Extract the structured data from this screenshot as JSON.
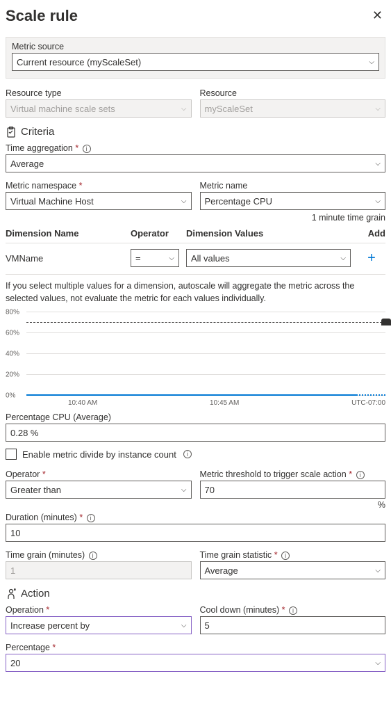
{
  "header": {
    "title": "Scale rule"
  },
  "metric_source": {
    "label": "Metric source",
    "value": "Current resource (myScaleSet)"
  },
  "resource_type": {
    "label": "Resource type",
    "value": "Virtual machine scale sets"
  },
  "resource": {
    "label": "Resource",
    "value": "myScaleSet"
  },
  "criteria": {
    "title": "Criteria",
    "time_agg": {
      "label": "Time aggregation",
      "value": "Average"
    },
    "namespace": {
      "label": "Metric namespace",
      "value": "Virtual Machine Host"
    },
    "metric_name": {
      "label": "Metric name",
      "value": "Percentage CPU"
    },
    "time_grain_note": "1 minute time grain",
    "table": {
      "h_name": "Dimension Name",
      "h_op": "Operator",
      "h_val": "Dimension Values",
      "h_add": "Add",
      "row_name": "VMName",
      "row_op": "=",
      "row_val": "All values"
    },
    "help": "If you select multiple values for a dimension, autoscale will aggregate the metric across the selected values, not evaluate the metric for each values individually.",
    "chart_metric_label": "Percentage CPU (Average)",
    "chart_metric_value": "0.28 %",
    "divide_label": "Enable metric divide by instance count",
    "operator": {
      "label": "Operator",
      "value": "Greater than"
    },
    "threshold": {
      "label": "Metric threshold to trigger scale action",
      "value": "70",
      "suffix": "%"
    },
    "duration": {
      "label": "Duration (minutes)",
      "value": "10"
    },
    "time_grain_min": {
      "label": "Time grain (minutes)",
      "value": "1"
    },
    "time_grain_stat": {
      "label": "Time grain statistic",
      "value": "Average"
    }
  },
  "action": {
    "title": "Action",
    "operation": {
      "label": "Operation",
      "value": "Increase percent by"
    },
    "cooldown": {
      "label": "Cool down (minutes)",
      "value": "5"
    },
    "percentage": {
      "label": "Percentage",
      "value": "20"
    }
  },
  "chart_data": {
    "type": "line",
    "title": "Percentage CPU (Average)",
    "ylabel": "%",
    "ylim": [
      0,
      80
    ],
    "threshold_line": 70,
    "x_ticks": [
      "10:40 AM",
      "10:45 AM"
    ],
    "timezone": "UTC-07:00",
    "series": [
      {
        "name": "Percentage CPU",
        "values": [
          0.28,
          0.28,
          0.28,
          0.28,
          0.28,
          0.28,
          0.28,
          0.28,
          0.28,
          0.28
        ]
      }
    ]
  }
}
